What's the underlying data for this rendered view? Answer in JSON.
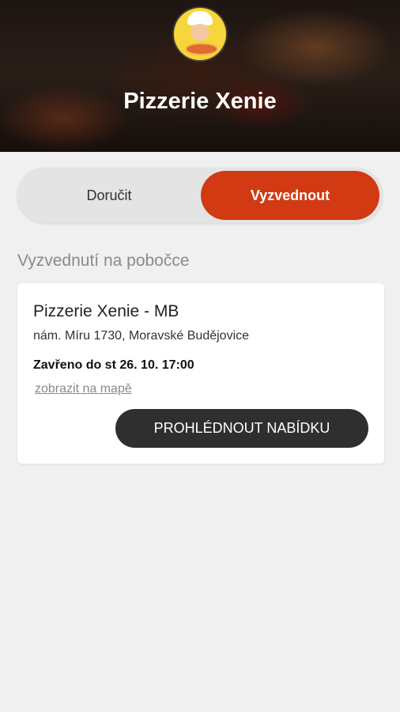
{
  "header": {
    "title": "Pizzerie Xenie",
    "logo_icon": "chef-logo-icon"
  },
  "order_mode": {
    "options": [
      "Doručit",
      "Vyzvednout"
    ],
    "selected": "Vyzvednout",
    "accent_color": "#d13a12"
  },
  "pickup": {
    "section_label": "Vyzvednutí na pobočce",
    "branch": {
      "name": "Pizzerie Xenie - MB",
      "address": "nám. Míru 1730, Moravské Budějovice",
      "status": "Zavřeno do st 26. 10. 17:00",
      "map_link": "zobrazit na mapě",
      "menu_button": "PROHLÉDNOUT NABÍDKU"
    }
  }
}
